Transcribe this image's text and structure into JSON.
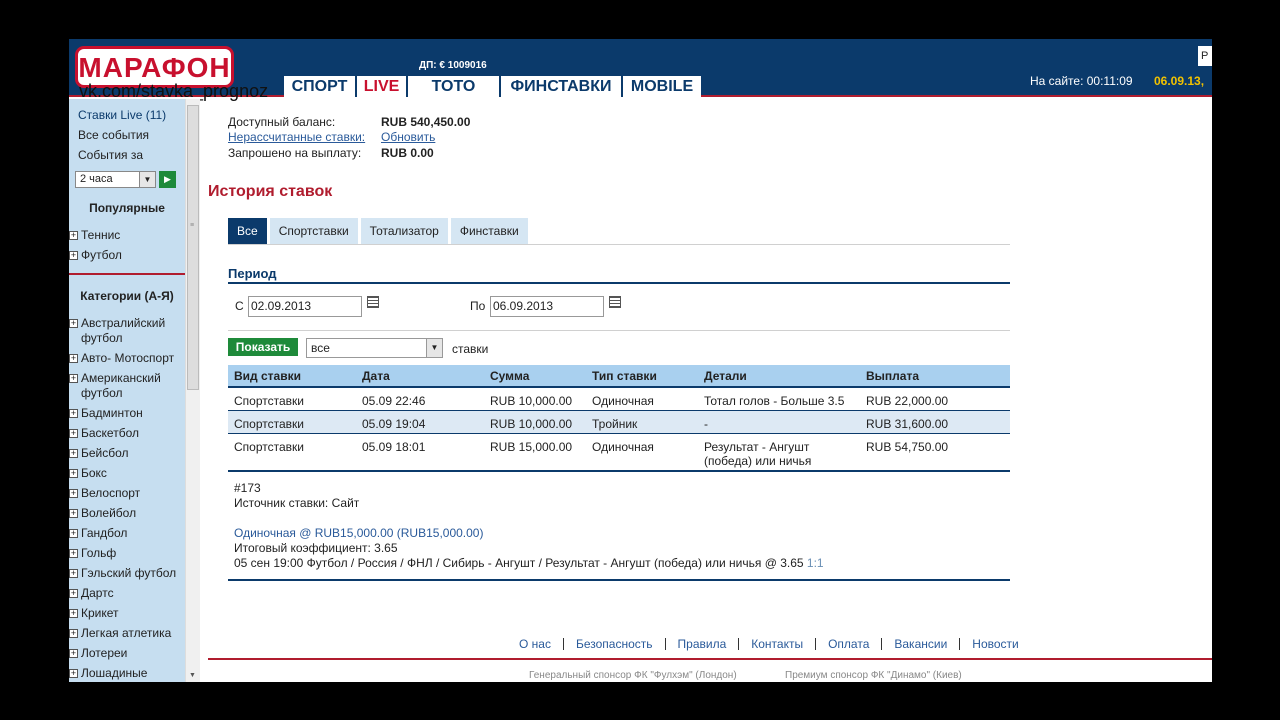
{
  "header": {
    "logo": "МАРАФОН",
    "watermark": "vk.com/stavka_prognoz",
    "dp": "ДП: € 1009016",
    "nav": [
      {
        "label": "СПОРТ"
      },
      {
        "label": "LIVE"
      },
      {
        "label": "ТОТО"
      },
      {
        "label": "ФИНСТАВКИ"
      },
      {
        "label": "MOBILE"
      }
    ],
    "online": "На сайте: 00:11:09",
    "date": "06.09.13,",
    "corner": "Р"
  },
  "sidebar": {
    "live": "Ставки Live (11)",
    "all_events": "Все события",
    "events_for": "События за",
    "period": "2 часа",
    "popular": "Популярные",
    "popular_items": [
      "Теннис",
      "Футбол"
    ],
    "categories_title": "Категории (А-Я)",
    "categories": [
      {
        "label": "Австралийский футбол"
      },
      {
        "label": "Авто- Мотоспорт"
      },
      {
        "label": "Американский футбол"
      },
      {
        "label": "Бадминтон"
      },
      {
        "label": "Баскетбол"
      },
      {
        "label": "Бейсбол"
      },
      {
        "label": "Бокс"
      },
      {
        "label": "Велоспорт"
      },
      {
        "label": "Волейбол"
      },
      {
        "label": "Гандбол"
      },
      {
        "label": "Гольф"
      },
      {
        "label": "Гэльский футбол"
      },
      {
        "label": "Дартс"
      },
      {
        "label": "Крикет"
      },
      {
        "label": "Легкая атлетика"
      },
      {
        "label": "Лотереи"
      },
      {
        "label": "Лошадиные"
      }
    ]
  },
  "balance": {
    "available_label": "Доступный баланс:",
    "available_value": "RUB 540,450.00",
    "unsettled_label": "Нерассчитанные ставки:",
    "unsettled_action": "Обновить",
    "requested_label": "Запрошено на выплату:",
    "requested_value": "RUB 0.00"
  },
  "page": {
    "title": "История ставок",
    "tabs": [
      "Все",
      "Спортставки",
      "Тотализатор",
      "Финставки"
    ],
    "period_label": "Период",
    "from_label": "С",
    "from_date": "02.09.2013",
    "to_label": "По",
    "to_date": "06.09.2013",
    "show_button": "Показать",
    "type_select": "все",
    "type_suffix": "ставки"
  },
  "table": {
    "headers": [
      "Вид ставки",
      "Дата",
      "Сумма",
      "Тип ставки",
      "Детали",
      "Выплата"
    ],
    "rows": [
      [
        "Спортставки",
        "05.09 22:46",
        "RUB 10,000.00",
        "Одиночная",
        "Тотал голов - Больше 3.5",
        "RUB 22,000.00"
      ],
      [
        "Спортставки",
        "05.09 19:04",
        "RUB 10,000.00",
        "Тройник",
        "-",
        "RUB 31,600.00"
      ],
      [
        "Спортставки",
        "05.09 18:01",
        "RUB 15,000.00",
        "Одиночная",
        "Результат - Ангушт",
        "RUB 54,750.00"
      ]
    ],
    "row3_details_line2": "(победа) или ничья"
  },
  "details": {
    "id": "#173",
    "source": "Источник ставки: Сайт",
    "bet_summary": "Одиночная @ RUB15,000.00 (RUB15,000.00)",
    "coef": "Итоговый коэффициент: 3.65",
    "event": "05 сен 19:00 Футбол / Россия / ФНЛ / Сибирь - Ангушт / Результат - Ангушт (победа) или ничья @ 3.65",
    "event_suffix": "1:1"
  },
  "footer": {
    "links": [
      "О нас",
      "Безопасность",
      "Правила",
      "Контакты",
      "Оплата",
      "Вакансии",
      "Новости"
    ],
    "sponsor1": "Генеральный спонсор ФК \"Фулхэм\" (Лондон)",
    "sponsor2": "Премиум спонсор ФК \"Динамо\" (Киев)"
  },
  "colors": {
    "brand_navy": "#0b3a6b",
    "brand_red": "#c8102e",
    "accent_yellow": "#f2c200",
    "button_green": "#1e8a3a"
  }
}
